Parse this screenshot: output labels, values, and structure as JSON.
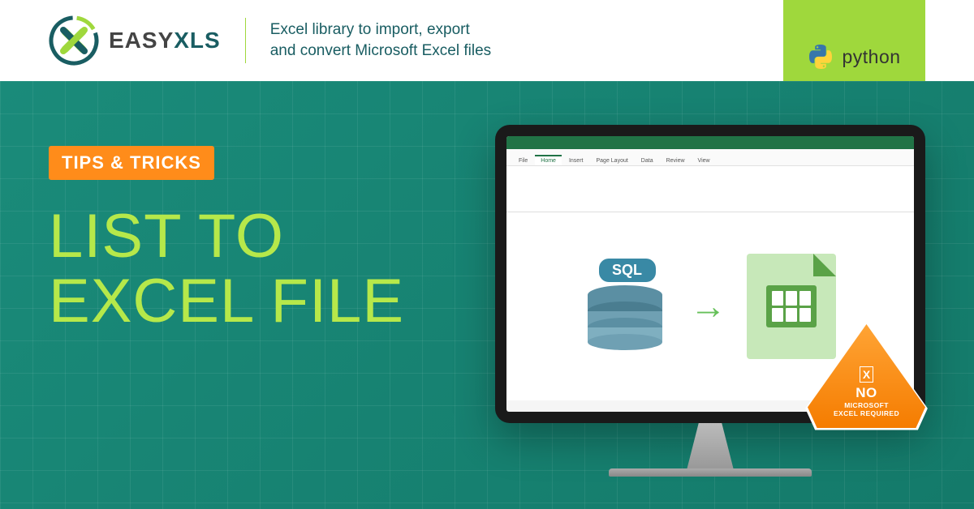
{
  "header": {
    "logo_easy": "EASY",
    "logo_xls": "XLS",
    "tagline_line1": "Excel library to import, export",
    "tagline_line2": "and convert Microsoft Excel files"
  },
  "ribbon": {
    "language": "python"
  },
  "content": {
    "badge": "TIPS & TRICKS",
    "title_line1": "LIST TO",
    "title_line2": "EXCEL FILE"
  },
  "illustration": {
    "db_label": "SQL",
    "excel_tabs": [
      "File",
      "Home",
      "Insert",
      "Page Layout",
      "Data",
      "Review",
      "View"
    ],
    "excel_active_tab": "Home"
  },
  "warning": {
    "icon_label": "X",
    "line1": "NO",
    "line2": "MICROSOFT",
    "line3": "EXCEL REQUIRED"
  }
}
